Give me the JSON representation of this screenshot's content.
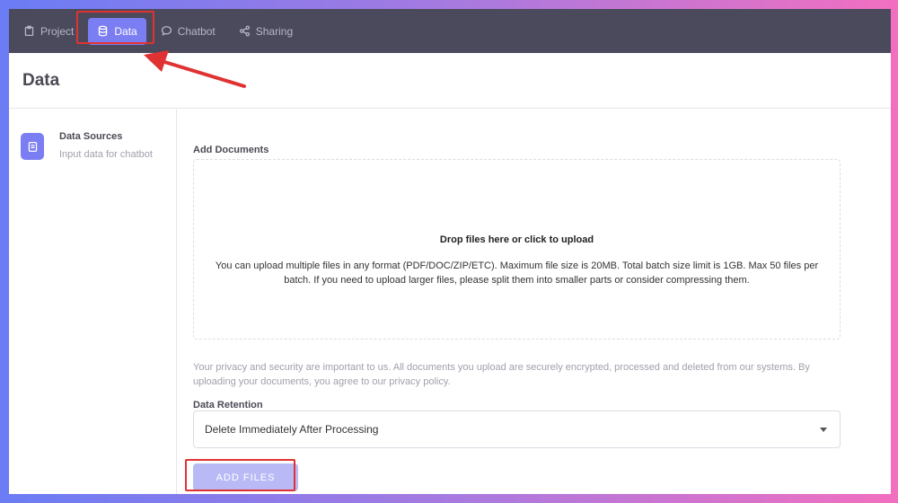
{
  "nav": {
    "items": [
      {
        "label": "Project",
        "icon": "clipboard-icon"
      },
      {
        "label": "Data",
        "icon": "database-icon",
        "active": true
      },
      {
        "label": "Chatbot",
        "icon": "chat-icon"
      },
      {
        "label": "Sharing",
        "icon": "share-icon"
      }
    ]
  },
  "page": {
    "title": "Data"
  },
  "sidebar": {
    "title": "Data Sources",
    "subtitle": "Input data for chatbot"
  },
  "main": {
    "add_documents_label": "Add Documents",
    "drop_title": "Drop files here or click to upload",
    "drop_desc": "You can upload multiple files in any format (PDF/DOC/ZIP/ETC). Maximum file size is 20MB. Total batch size limit is 1GB. Max 50 files per batch. If you need to upload larger files, please split them into smaller parts or consider compressing them.",
    "privacy": "Your privacy and security are important to us. All documents you upload are securely encrypted, processed and deleted from our systems. By uploading your documents, you agree to our privacy policy.",
    "retention_label": "Data Retention",
    "retention_value": "Delete Immediately After Processing",
    "add_files_label": "ADD FILES"
  },
  "colors": {
    "accent": "#7b7ef2",
    "nav_bg": "#4a4a5c",
    "highlight": "#e03232"
  }
}
